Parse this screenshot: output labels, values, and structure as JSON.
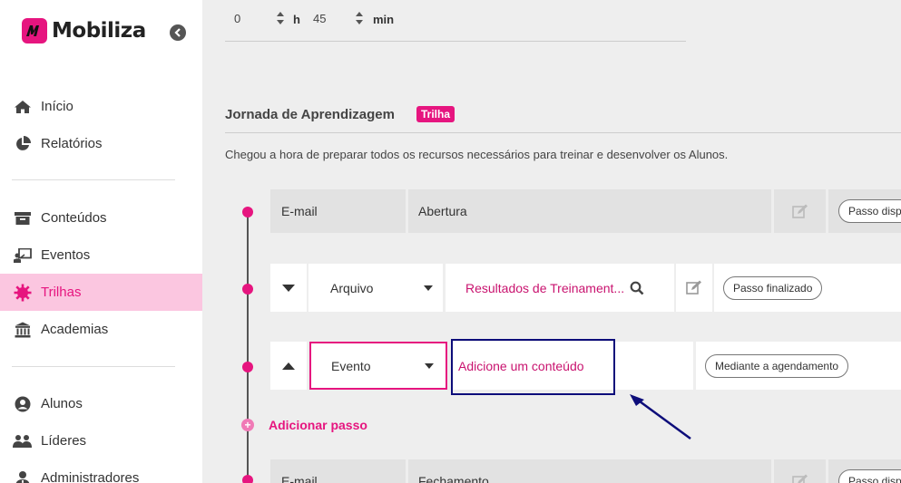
{
  "brand": {
    "name": "Mobiliza",
    "color": "#e6157f"
  },
  "nav": {
    "group1": [
      {
        "label": "Início",
        "icon": "home-icon"
      },
      {
        "label": "Relatórios",
        "icon": "pie-chart-icon"
      }
    ],
    "group2": [
      {
        "label": "Conteúdos",
        "icon": "archive-icon"
      },
      {
        "label": "Eventos",
        "icon": "presentation-icon"
      },
      {
        "label": "Trilhas",
        "icon": "trilhas-icon",
        "active": true
      },
      {
        "label": "Academias",
        "icon": "academy-icon"
      }
    ],
    "group3": [
      {
        "label": "Alunos",
        "icon": "user-icon"
      },
      {
        "label": "Líderes",
        "icon": "users-icon"
      },
      {
        "label": "Administradores",
        "icon": "admin-icon"
      }
    ]
  },
  "duration": {
    "hours": "0",
    "hours_unit": "h",
    "minutes": "45",
    "minutes_unit": "min"
  },
  "journey": {
    "title": "Jornada de Aprendizagem",
    "badge": "Trilha",
    "description": "Chegou a hora de preparar todos os recursos necessários para treinar e desenvolver os Alunos."
  },
  "steps": [
    {
      "type": "E-mail",
      "content": "Abertura",
      "status": "Passo disponível"
    },
    {
      "type": "Arquivo",
      "content": "Resultados de Treinament...",
      "status": "Passo finalizado"
    },
    {
      "type": "Evento",
      "content": "Adicione um conteúdo",
      "status": "Mediante a agendamento"
    },
    {
      "type": "E-mail",
      "content": "Fechamento",
      "status": "Passo disponível"
    }
  ],
  "add_step": {
    "label": "Adicionar passo"
  }
}
